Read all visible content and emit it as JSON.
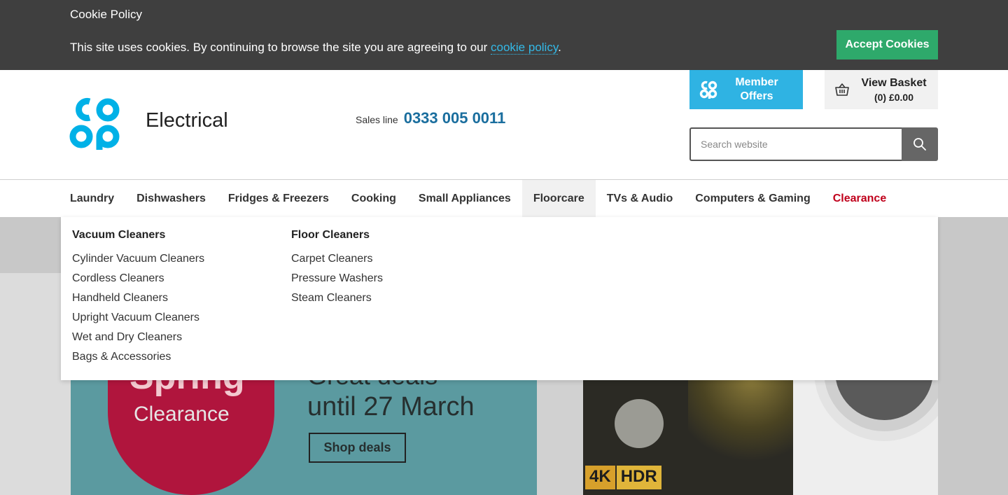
{
  "cookie": {
    "title": "Cookie Policy",
    "text_before": "This site uses cookies. By continuing to browse the site you are agreeing to our ",
    "link_text": "cookie policy",
    "text_after": ".",
    "accept_label": "Accept Cookies"
  },
  "header": {
    "brand_sub": "Electrical",
    "sales_label": "Sales line",
    "sales_number": "0333 005 0011",
    "member_label": "Member Offers",
    "basket_label": "View Basket",
    "basket_amount": "(0) £0.00",
    "search_placeholder": "Search website"
  },
  "nav": {
    "items": [
      "Laundry",
      "Dishwashers",
      "Fridges & Freezers",
      "Cooking",
      "Small Appliances",
      "Floorcare",
      "TVs & Audio",
      "Computers & Gaming",
      "Clearance"
    ],
    "active": "Floorcare"
  },
  "dropdown": {
    "col1": {
      "heading": "Vacuum Cleaners",
      "links": [
        "Cylinder Vacuum Cleaners",
        "Cordless Cleaners",
        "Handheld Cleaners",
        "Upright Vacuum Cleaners",
        "Wet and Dry Cleaners",
        "Bags & Accessories"
      ]
    },
    "col2": {
      "heading": "Floor Cleaners",
      "links": [
        "Carpet Cleaners",
        "Pressure Washers",
        "Steam Cleaners"
      ]
    }
  },
  "hero": {
    "spring": "Spring",
    "clearance": "Clearance",
    "deals": "Great deals",
    "until": "until 27 March",
    "shop_label": "Shop deals",
    "badge_4k": "4K",
    "badge_hdr": "HDR"
  },
  "colors": {
    "cookie_bg": "#3f3f3f",
    "accept_green": "#2ea96b",
    "coop_blue": "#00b1e7",
    "member_blue": "#2fb3e3",
    "sales_blue": "#1a6e9e",
    "clearance_red": "#c0001b"
  }
}
